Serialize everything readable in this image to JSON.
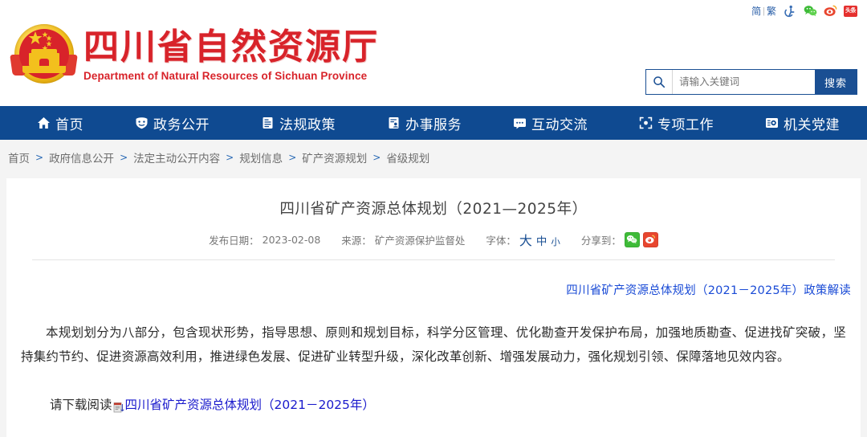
{
  "topbar": {
    "lang_simplified": "简",
    "lang_separator": "|",
    "lang_traditional": "繁",
    "icons": [
      {
        "name": "accessibility-icon",
        "label": "无障碍"
      },
      {
        "name": "wechat-icon",
        "label": "微信"
      },
      {
        "name": "weibo-icon",
        "label": "微博"
      },
      {
        "name": "toutiao-icon",
        "label": "头条"
      }
    ]
  },
  "site": {
    "emblem_name": "national-emblem",
    "title_cn": "四川省自然资源厅",
    "title_en": "Department of Natural Resources of Sichuan Province"
  },
  "search": {
    "placeholder": "请输入关键词",
    "value": "",
    "button_label": "搜索",
    "icon": "search-icon"
  },
  "nav": {
    "items": [
      {
        "label": "首页",
        "icon": "home-icon"
      },
      {
        "label": "政务公开",
        "icon": "shield-icon"
      },
      {
        "label": "法规政策",
        "icon": "document-icon"
      },
      {
        "label": "办事服务",
        "icon": "clipboard-person-icon"
      },
      {
        "label": "互动交流",
        "icon": "chat-icon"
      },
      {
        "label": "专项工作",
        "icon": "target-icon"
      },
      {
        "label": "机关党建",
        "icon": "badge-icon"
      }
    ]
  },
  "breadcrumb": {
    "separator": ">",
    "items": [
      "首页",
      "政府信息公开",
      "法定主动公开内容",
      "规划信息",
      "矿产资源规划",
      "省级规划"
    ]
  },
  "article": {
    "title": "四川省矿产资源总体规划（2021—2025年）",
    "meta": {
      "publish_label": "发布日期：",
      "publish_date": "2023-02-08",
      "source_label": "来源：",
      "source_value": "矿产资源保护监督处",
      "font_label": "字体：",
      "font_large": "大",
      "font_medium": "中",
      "font_small": "小",
      "share_label": "分享到：",
      "share_icons": [
        {
          "name": "share-wechat-icon",
          "color": "#3ebb38"
        },
        {
          "name": "share-weibo-icon",
          "color": "#e8462f"
        }
      ]
    },
    "policy_link": "四川省矿产资源总体规划（2021－2025年）政策解读",
    "body": "本规划划分为八部分，包含现状形势，指导思想、原则和规划目标，科学分区管理、优化勘查开发保护布局，加强地质勘查、促进找矿突破，坚持集约节约、促进资源高效利用，推进绿色发展、促进矿业转型升级，深化改革创新、增强发展动力，强化规划引领、保障落地见效内容。",
    "download_prefix": "请下载阅读",
    "download_icon": "file-attachment-icon",
    "download_link": "四川省矿产资源总体规划（2021－2025年）"
  },
  "colors": {
    "brand_red": "#d8232a",
    "nav_blue": "#0f4a91",
    "link_blue": "#1a4bd6",
    "page_bg": "#f4f4f4"
  }
}
